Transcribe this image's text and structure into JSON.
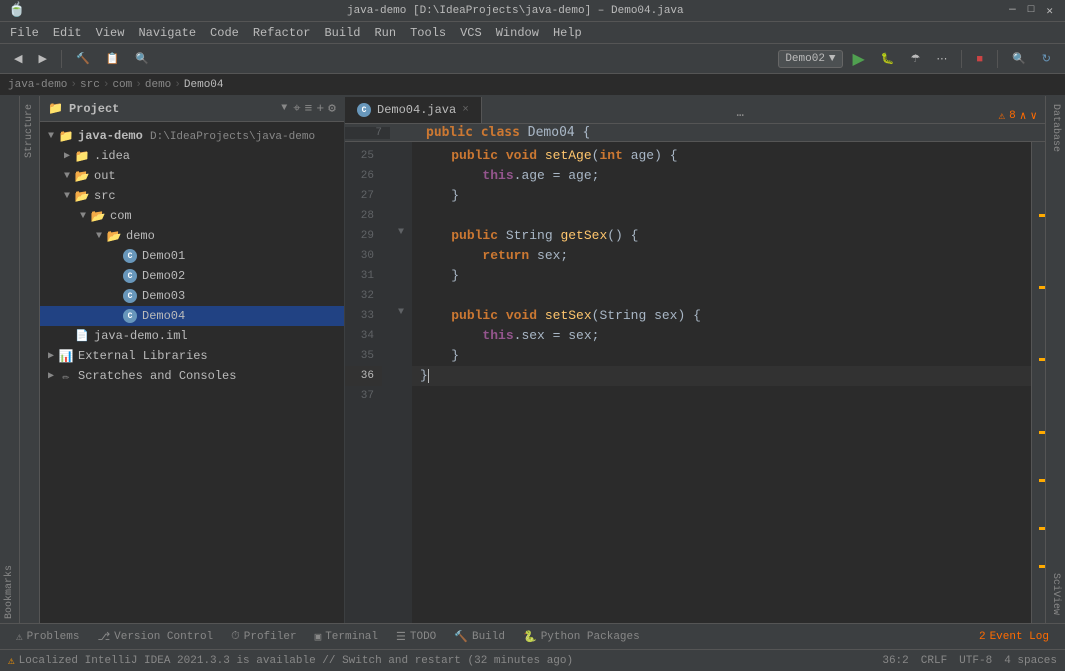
{
  "titlebar": {
    "title": "java-demo [D:\\IdeaProjects\\java-demo] – Demo04.java",
    "minimize": "—",
    "maximize": "□",
    "close": "✕"
  },
  "menubar": {
    "items": [
      "File",
      "Edit",
      "View",
      "Navigate",
      "Code",
      "Refactor",
      "Build",
      "Run",
      "Tools",
      "VCS",
      "Window",
      "Help"
    ]
  },
  "toolbar": {
    "run_config": "Demo02",
    "run_icon": "▶",
    "build_icon": "🔨",
    "search_icon": "🔍",
    "navigate_back": "←",
    "navigate_fwd": "→"
  },
  "breadcrumb": {
    "items": [
      "java-demo",
      "src",
      "com",
      "demo",
      "Demo04"
    ],
    "separators": [
      ">",
      ">",
      ">",
      ">"
    ]
  },
  "project_panel": {
    "title": "Project",
    "root": {
      "name": "java-demo",
      "path": "D:\\IdeaProjects\\java-demo",
      "children": [
        {
          "name": ".idea",
          "type": "folder",
          "expanded": false,
          "depth": 1
        },
        {
          "name": "out",
          "type": "folder",
          "expanded": true,
          "depth": 1,
          "selected": false
        },
        {
          "name": "src",
          "type": "folder",
          "expanded": true,
          "depth": 1,
          "children": [
            {
              "name": "com",
              "type": "folder",
              "expanded": true,
              "depth": 2,
              "children": [
                {
                  "name": "demo",
                  "type": "folder",
                  "expanded": true,
                  "depth": 3,
                  "children": [
                    {
                      "name": "Demo01",
                      "type": "java",
                      "depth": 4
                    },
                    {
                      "name": "Demo02",
                      "type": "java",
                      "depth": 4
                    },
                    {
                      "name": "Demo03",
                      "type": "java",
                      "depth": 4
                    },
                    {
                      "name": "Demo04",
                      "type": "java",
                      "depth": 4,
                      "selected": true
                    }
                  ]
                }
              ]
            }
          ]
        },
        {
          "name": "java-demo.iml",
          "type": "iml",
          "depth": 1
        },
        {
          "name": "External Libraries",
          "type": "lib",
          "expanded": false,
          "depth": 1
        },
        {
          "name": "Scratches and Consoles",
          "type": "scratch",
          "expanded": false,
          "depth": 1
        }
      ]
    }
  },
  "editor": {
    "filename": "Demo04.java",
    "tab_close": "×",
    "lines": [
      {
        "num": 25,
        "content": "    public void setAge(int age) {",
        "has_fold": false
      },
      {
        "num": 26,
        "content": "        this.age = age;",
        "has_fold": false
      },
      {
        "num": 27,
        "content": "    }",
        "has_fold": false
      },
      {
        "num": 28,
        "content": "",
        "has_fold": false
      },
      {
        "num": 29,
        "content": "    public String getSex() {",
        "has_fold": true
      },
      {
        "num": 30,
        "content": "        return sex;",
        "has_fold": false
      },
      {
        "num": 31,
        "content": "    }",
        "has_fold": false
      },
      {
        "num": 32,
        "content": "",
        "has_fold": false
      },
      {
        "num": 33,
        "content": "    public void setSex(String sex) {",
        "has_fold": true
      },
      {
        "num": 34,
        "content": "        this.sex = sex;",
        "has_fold": false
      },
      {
        "num": 35,
        "content": "    }",
        "has_fold": false
      },
      {
        "num": 36,
        "content": "}",
        "has_fold": false,
        "is_current": true
      },
      {
        "num": 37,
        "content": "",
        "has_fold": false
      }
    ],
    "header_line": {
      "num": 7,
      "content": "public class Demo04 {"
    },
    "warnings_count": "8",
    "cursor_position": "36:2",
    "encoding": "UTF-8",
    "line_ending": "CRLF",
    "indent": "4 spaces"
  },
  "bottom_tabs": {
    "items": [
      {
        "icon": "⚠",
        "label": "Problems"
      },
      {
        "icon": "⎇",
        "label": "Version Control"
      },
      {
        "icon": "⏱",
        "label": "Profiler"
      },
      {
        "icon": "▣",
        "label": "Terminal"
      },
      {
        "icon": "☰",
        "label": "TODO"
      },
      {
        "icon": "🔨",
        "label": "Build"
      },
      {
        "icon": "🐍",
        "label": "Python Packages"
      }
    ],
    "right_items": [
      {
        "label": "2",
        "icon": "📋",
        "title": "Event Log"
      }
    ]
  },
  "status_bar": {
    "message": "Localized IntelliJ IDEA 2021.3.3 is available // Switch and restart (32 minutes ago)",
    "position": "36:2",
    "line_ending": "CRLF",
    "encoding": "UTF-8",
    "indent": "4 spaces"
  },
  "right_panels": {
    "database": "Database",
    "sciview": "SciView"
  },
  "colors": {
    "bg": "#2b2b2b",
    "panel_bg": "#3c3f41",
    "selected": "#214283",
    "keyword": "#cc7832",
    "string": "#6a8759",
    "number": "#6897bb",
    "method": "#ffc66d",
    "comment": "#808080",
    "this": "#94558d",
    "warning_orange": "#ffaa00"
  }
}
